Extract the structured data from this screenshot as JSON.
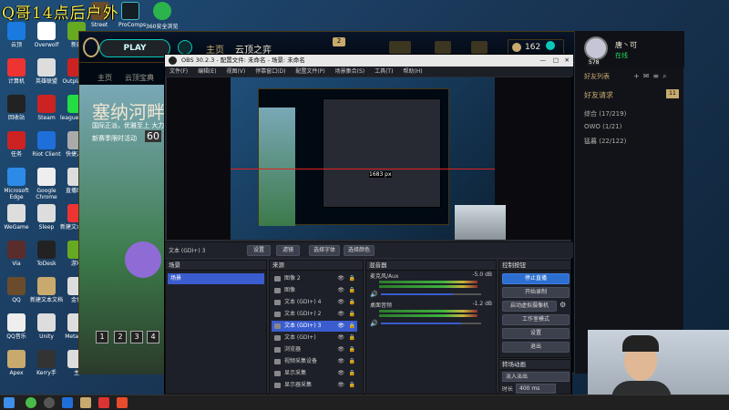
{
  "overlay": {
    "title": "Q哥14点后户外"
  },
  "desktop_icons": [
    "云顶",
    "计算机",
    "回收站",
    "任务",
    "Microsoft Edge",
    "WeGame",
    "Via",
    "QQ",
    "QQ音乐",
    "Apex",
    "Overwolf",
    "英雄联盟",
    "Steam",
    "Riot Client",
    "Google Chrome",
    "Sleep",
    "ToDesk",
    "新建文本文档",
    "Unity",
    "Kerry手",
    "新建",
    "Outplayed",
    "league_of_...",
    "快捷方式",
    "直播助手",
    "新建文本文档",
    "游戏",
    "金色",
    "MetaTFT",
    "主"
  ],
  "top_icons": [
    {
      "label": "Street"
    },
    {
      "label": "ProComps"
    },
    {
      "label": "360安全浏览"
    }
  ],
  "lol": {
    "play": "PLAY",
    "nav": [
      "主页",
      "云顶之弈"
    ],
    "currency": "162",
    "player_name": "唐丶可",
    "player_status": "在线",
    "player_level": "578",
    "subnav": [
      "主页",
      "云顶宝典"
    ],
    "hero_title": "塞纳河畔",
    "hero_sub": "国际正派，优雅至上 大力",
    "hero_sub2": "新赛季限时活动",
    "hero_count": "60",
    "pages": [
      "1",
      "2",
      "3",
      "4"
    ],
    "friends": {
      "header": "好友列表",
      "requests": "好友请求",
      "requests_count": "11",
      "groups": [
        "综合 (17/219)",
        "OWO (1/21)",
        "猛暮 (22/122)"
      ]
    }
  },
  "obs": {
    "title": "OBS 30.2.3 - 配置文件: 未命名 - 场景: 未命名",
    "menu": [
      "文件(F)",
      "编辑(E)",
      "视图(V)",
      "停靠窗口(D)",
      "配置文件(P)",
      "场景集合(S)",
      "工具(T)",
      "帮助(H)"
    ],
    "source_label": "文本 (GDI+) 3",
    "toolbar": [
      "设置",
      "滤镜",
      "选择字体",
      "选择颜色"
    ],
    "scenes": {
      "header": "场景",
      "items": [
        "场景"
      ]
    },
    "sources": {
      "header": "来源",
      "items": [
        "图像 2",
        "图像",
        "文本 (GDI+) 4",
        "文本 (GDI+) 2",
        "文本 (GDI+) 3",
        "文本 (GDI+)",
        "浏览器",
        "视频采集设备",
        "显示采集",
        "显示器采集"
      ]
    },
    "mixer": {
      "header": "混音器",
      "tracks": [
        {
          "name": "麦克风/Aux",
          "db": "-5.0 dB",
          "level": 0.72
        },
        {
          "name": "桌面音频",
          "db": "-1.2 dB",
          "level": 0.8
        }
      ]
    },
    "controls": {
      "header": "控制按钮",
      "buttons": [
        "停止直播",
        "开始录制",
        "启动虚拟摄像机",
        "工作室模式",
        "设置",
        "退出"
      ]
    },
    "transitions": {
      "header": "转场动画",
      "type": "淡入淡出",
      "duration_label": "时长",
      "duration": "400 ms"
    },
    "preview_label": "1683 px"
  },
  "colors": {
    "accent": "#c8aa6e",
    "obs_button": "#2d6fd0",
    "stream_active": "#3a5ccf"
  }
}
